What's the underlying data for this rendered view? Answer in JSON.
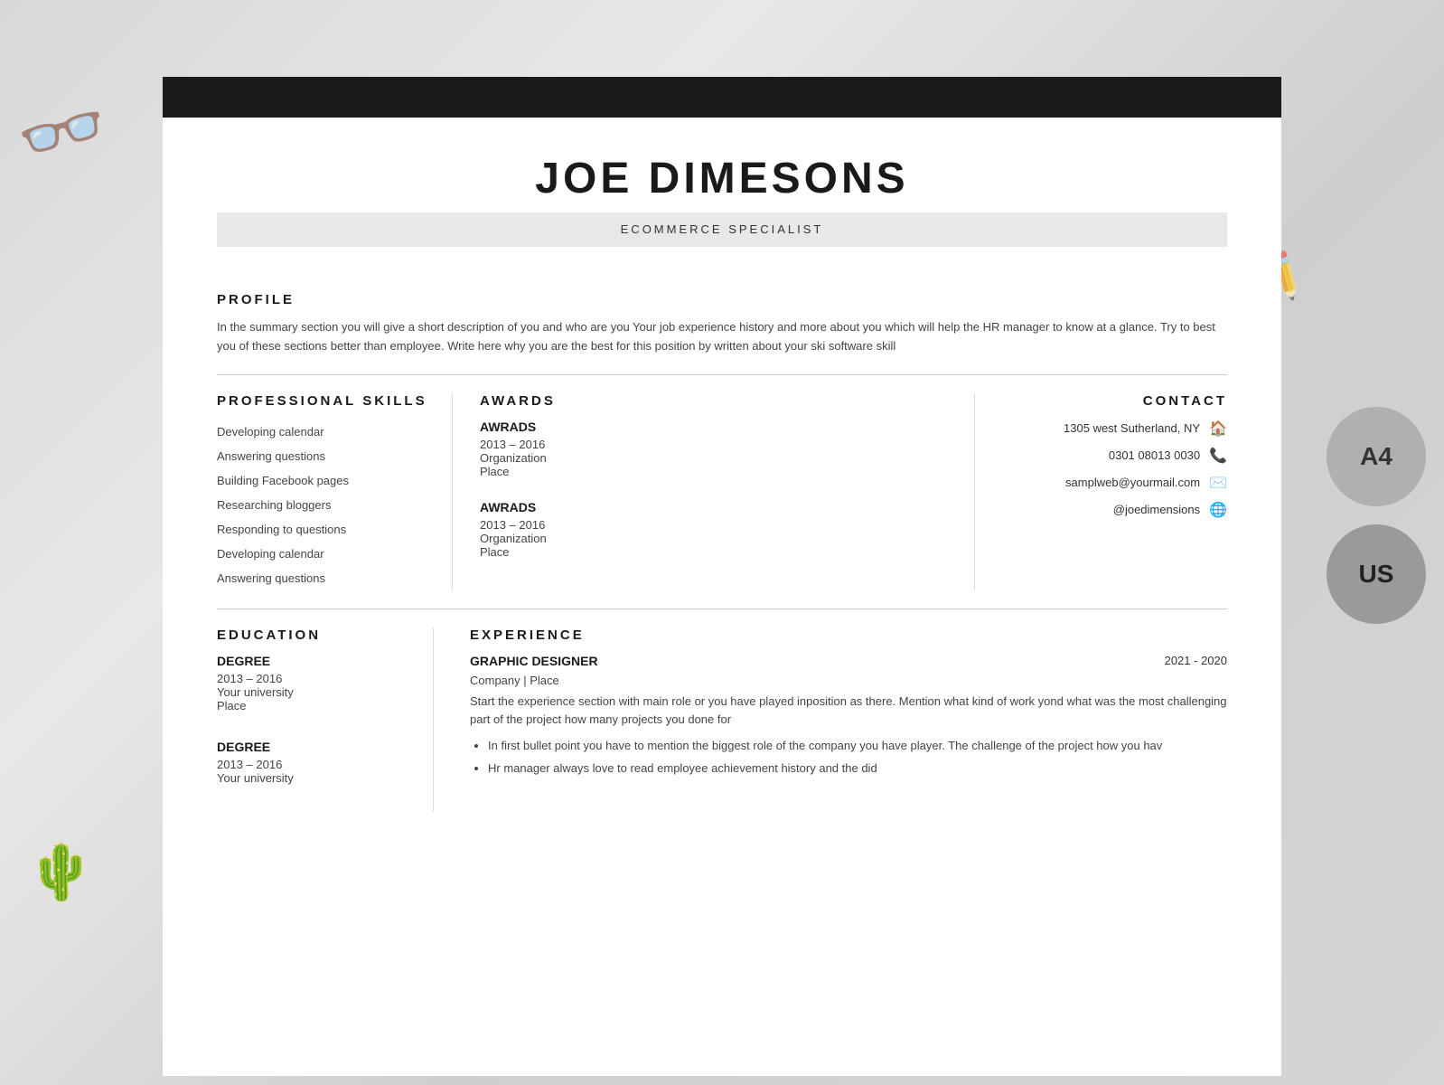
{
  "background": {
    "color": "#c8c8c8"
  },
  "circles": {
    "a4_label": "A4",
    "us_label": "US"
  },
  "resume": {
    "name": "JOE DIMESONS",
    "title": "ECOMMERCE SPECIALIST",
    "profile": {
      "heading": "PROFILE",
      "text": "In the summary section you will give a short description of you and who are you Your job experience history and more about you which will help the HR manager to know at a glance. Try to best you of these sections better than employee. Write here why you are the best for this position by written about your ski software skill"
    },
    "skills": {
      "heading": "PROFESSIONAL SKILLS",
      "items": [
        "Developing calendar",
        "Answering questions",
        "Building Facebook pages",
        "Researching bloggers",
        "Responding to questions",
        "Developing calendar",
        "Answering questions"
      ]
    },
    "awards": {
      "heading": "AWARDS",
      "entries": [
        {
          "title": "AWRADS",
          "date": "2013 – 2016",
          "org": "Organization",
          "place": "Place"
        },
        {
          "title": "AWRADS",
          "date": "2013 – 2016",
          "org": "Organization",
          "place": "Place"
        }
      ]
    },
    "contact": {
      "heading": "CONTACT",
      "address": "1305 west Sutherland, NY",
      "phone": "0301 08013 0030",
      "email": "samplweb@yourmail.com",
      "website": "@joedimensions"
    },
    "education": {
      "heading": "EDUCATION",
      "entries": [
        {
          "degree": "DEGREE",
          "date": "2013 – 2016",
          "university": "Your university",
          "place": "Place"
        },
        {
          "degree": "DEGREE",
          "date": "2013 – 2016",
          "university": "Your university",
          "place": ""
        }
      ]
    },
    "experience": {
      "heading": "EXPERIENCE",
      "entries": [
        {
          "title": "GRAPHIC DESIGNER",
          "dates": "2021 - 2020",
          "company": "Company | Place",
          "description": "Start the experience section with main role or you have played inposition as there. Mention what kind of work yond what was the most challenging part of the project how many projects you done for",
          "bullets": [
            "In first bullet point you have to mention the biggest role of the company you have player. The challenge of the project how you hav",
            "Hr manager always love to read employee achievement history and the did"
          ]
        }
      ]
    }
  }
}
